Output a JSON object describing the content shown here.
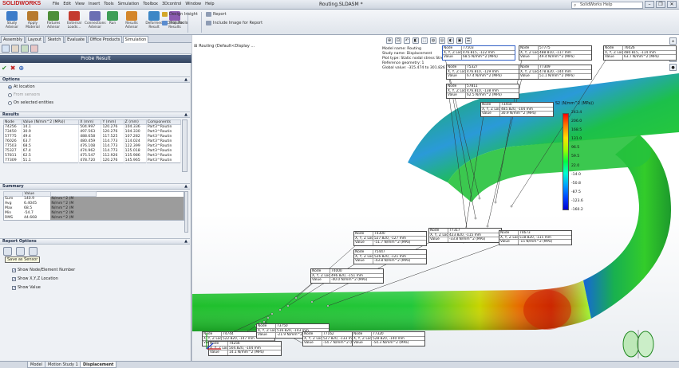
{
  "app": {
    "logo": "SOLIDWORKS",
    "document_title": "Routing.SLDASM *",
    "search_placeholder": "SolidWorks Help"
  },
  "menu": [
    "File",
    "Edit",
    "View",
    "Insert",
    "Tools",
    "Simulation",
    "Toolbox",
    "3Dcontrol",
    "Window",
    "Help"
  ],
  "toolbar": {
    "tools": [
      {
        "label": "Study Advisor",
        "color": "#3d7cc9"
      },
      {
        "label": "Apply Material",
        "color": "#b77a2e"
      },
      {
        "label": "Fixtures Advisor",
        "color": "#4f8f3a"
      },
      {
        "label": "External Loads...",
        "color": "#c43b2f"
      },
      {
        "label": "Connections Advisor",
        "color": "#6b6fb3"
      },
      {
        "label": "Run",
        "color": "#3f9e57"
      },
      {
        "label": "Results Advisor",
        "color": "#d4862a"
      },
      {
        "label": "Deformed Result",
        "color": "#3c87c6"
      },
      {
        "label": "Compare Results",
        "color": "#8b5ab0"
      }
    ],
    "small_tools": [
      {
        "label": "Design Insight"
      },
      {
        "label": "Plot Tools"
      },
      {
        "label": "Report"
      },
      {
        "label": "Include Image for Report"
      }
    ]
  },
  "tabs": [
    "Assembly",
    "Layout",
    "Sketch",
    "Evaluate",
    "Office Products",
    "Simulation"
  ],
  "active_tab": "Simulation",
  "panel": {
    "title": "Probe Result",
    "ok": "✔",
    "cancel": "✖",
    "pin": "⊕",
    "options": {
      "header": "Options",
      "choices": [
        {
          "label": "At location",
          "selected": true,
          "enabled": true
        },
        {
          "label": "From sensors",
          "selected": false,
          "enabled": false
        },
        {
          "label": "On selected entities",
          "selected": false,
          "enabled": true
        }
      ]
    },
    "results": {
      "header": "Results",
      "columns": [
        "Node",
        "Value (N/mm^2 (MPa))",
        "X (mm)",
        "Y (mm)",
        "Z (mm)",
        "Components"
      ],
      "rows": [
        [
          "74256",
          "14.1",
          "504.997",
          "120.276",
          "104.336",
          "Part3^Routin"
        ],
        [
          "73450",
          "30.9",
          "497.563",
          "120.276",
          "104.330",
          "Part3^Routin"
        ],
        [
          "57775",
          "49.4",
          "488.658",
          "117.525",
          "107.282",
          "Part3^Routin"
        ],
        [
          "76026",
          "63.7",
          "480.459",
          "114.773",
          "114.024",
          "Part3^Routin"
        ],
        [
          "77503",
          "68.5",
          "476.108",
          "114.773",
          "122.399",
          "Part3^Routin"
        ],
        [
          "75327",
          "67.4",
          "474.962",
          "114.773",
          "125.018",
          "Part3^Routin"
        ],
        [
          "57811",
          "62.5",
          "475.547",
          "112.926",
          "135.986",
          "Part3^Routin"
        ],
        [
          "77309",
          "51.1",
          "478.720",
          "120.276",
          "145.965",
          "Part3^Routin"
        ]
      ]
    },
    "summary": {
      "header": "Summary",
      "columns": [
        "",
        "Value",
        ""
      ],
      "rows": [
        [
          "Sum",
          "140.9",
          "N/mm^2 (M"
        ],
        [
          "Avg",
          "6.4045",
          "N/mm^2 (M"
        ],
        [
          "Max",
          "68.5",
          "N/mm^2 (M"
        ],
        [
          "Min",
          "-54.7",
          "N/mm^2 (M"
        ],
        [
          "RMS",
          "44.668",
          "N/mm^2 (M"
        ]
      ]
    },
    "report_options": {
      "header": "Report Options",
      "tooltip": "Save as Sensor",
      "checks": [
        {
          "label": "Show Node/Element Number",
          "checked": true
        },
        {
          "label": "Show X,Y,Z Location",
          "checked": true
        },
        {
          "label": "Show Value",
          "checked": true
        }
      ]
    }
  },
  "bottom_tabs": [
    "Model",
    "Motion Study 1",
    "Displacement"
  ],
  "active_bottom_tab": "Displacement",
  "graphics": {
    "tree_label": "Routing (Default<Display ...",
    "model_info": [
      "Model name: Routing",
      "Study name: Displacement",
      "Plot type: Static nodal stress Stress1",
      "Reference geometry: 1",
      "Global value: -315.474 to 301.826 N/m"
    ],
    "legend": {
      "title": "S2 (N/mm^2 (MPa))",
      "ticks": [
        "243.4",
        "206.0",
        "168.5",
        "131.0",
        "96.5",
        "59.5",
        "22.0",
        "-14.0",
        "-50.8",
        "-87.5",
        "-123.6",
        "-160.2"
      ]
    },
    "callout_keys": {
      "node": "Node",
      "loc": "X, Y, Z Location",
      "val": "Value"
    },
    "callouts": [
      {
        "node": "77503",
        "loc": "476.815, -122 mm",
        "val": "68.5  N/mm^2 (MPa)"
      },
      {
        "node": "57775",
        "loc": "488.810, -117 mm",
        "val": "49.4  N/mm^2 (MPa)"
      },
      {
        "node": "76026",
        "loc": "480.815, -114 mm",
        "val": "63.7  N/mm^2 (MPa)"
      },
      {
        "node": "75327",
        "loc": "476.810, -129 mm",
        "val": "67.4  N/mm^2 (MPa)"
      },
      {
        "node": "77309",
        "loc": "478.820, -144 mm",
        "val": "51.1  N/mm^2 (MPa)"
      },
      {
        "node": "57811",
        "loc": "476.810, -138 mm",
        "val": "62.5  N/mm^2 (MPa)"
      },
      {
        "node": "73450",
        "loc": "485.820, -104 mm",
        "val": "30.9  N/mm^2 (MPa)"
      },
      {
        "node": "74300",
        "loc": "527.820, -127 mm",
        "val": "-51.7  N/mm^2 (MPa)"
      },
      {
        "node": "77317",
        "loc": "423.820, -115 mm",
        "val": "-33.8  N/mm^2 (MPa)"
      },
      {
        "node": "74673",
        "loc": "518.820, -115 mm",
        "val": "-15  N/mm^2 (MPa)"
      },
      {
        "node": "75447",
        "loc": "526.820, -121 mm",
        "val": "-43.8  N/mm^2 (MPa)"
      },
      {
        "node": "74000",
        "loc": "496.820, -151 mm",
        "val": "-40.0  N/mm^2 (MPa)"
      },
      {
        "node": "74744",
        "loc": "522.820, -147 mm",
        "val": "-48.9  N/mm^2 (MPa)"
      },
      {
        "node": "73750",
        "loc": "516.820, -143 mm",
        "val": "-21.9  N/mm^2 (MPa)"
      },
      {
        "node": "77162",
        "loc": "527.820, -133 mm",
        "val": "-54.7  N/mm^2 (MPa)"
      },
      {
        "node": "77320",
        "loc": "528.820, -140 mm",
        "val": "-54.3  N/mm^2 (MPa)"
      },
      {
        "node": "74256",
        "loc": "504.820, -104 mm",
        "val": "14.1  N/mm^2 (MPa)"
      }
    ]
  }
}
